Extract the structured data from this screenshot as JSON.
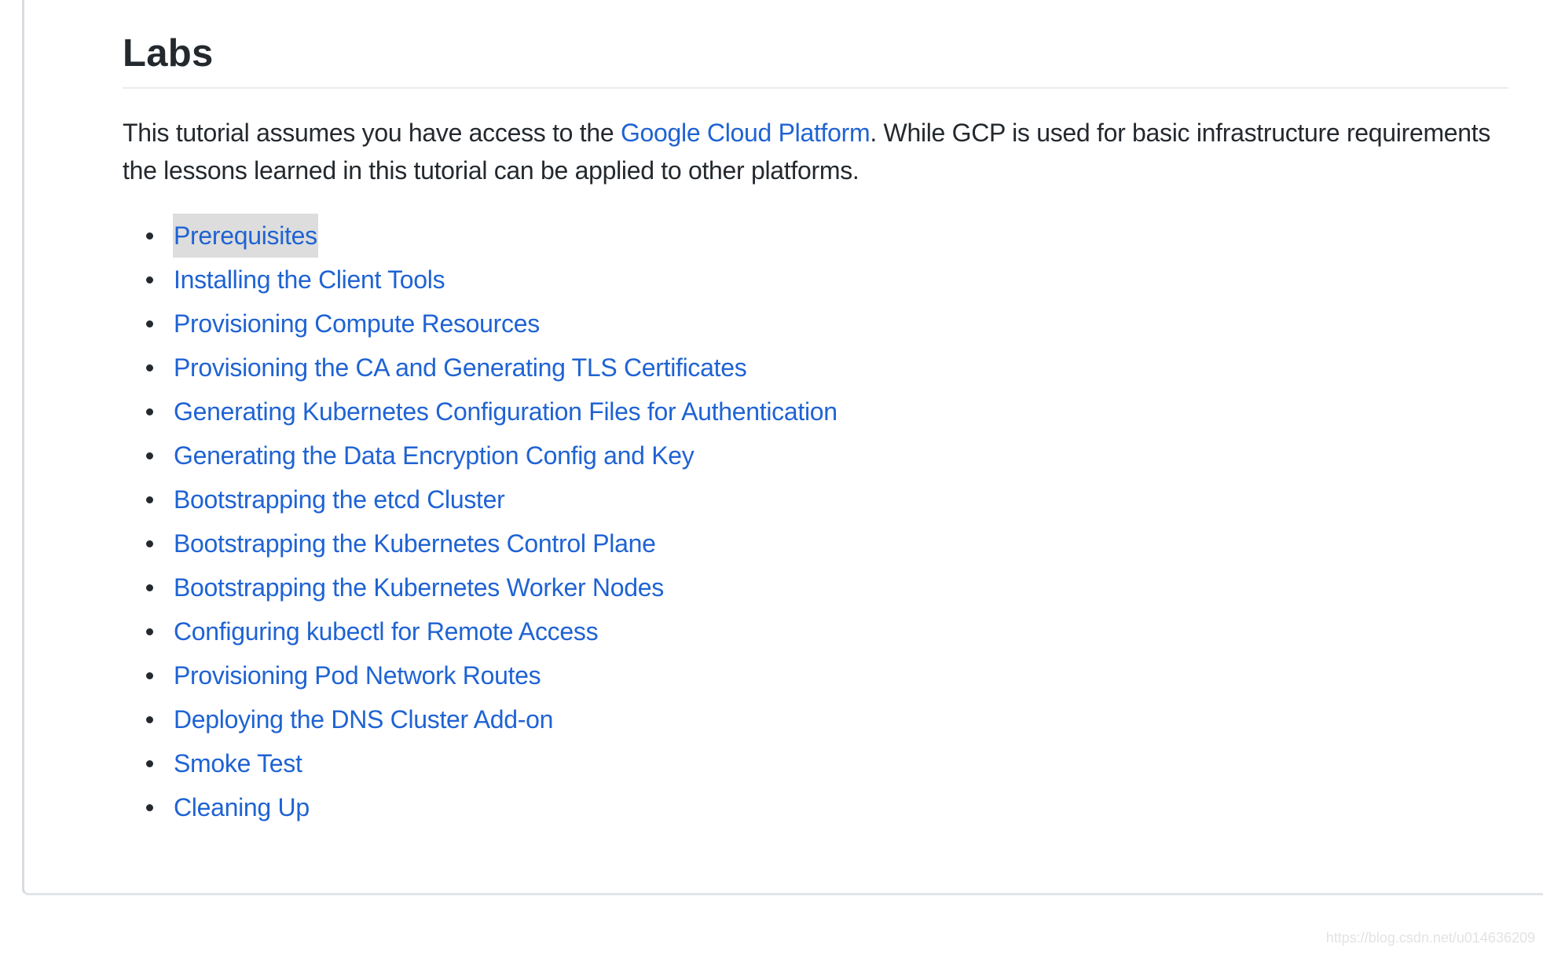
{
  "heading": "Labs",
  "intro": {
    "before_link": "This tutorial assumes you have access to the ",
    "link_text": "Google Cloud Platform",
    "after_link": ". While GCP is used for basic infrastructure requirements the lessons learned in this tutorial can be applied to other platforms."
  },
  "labs": [
    {
      "label": "Prerequisites",
      "highlighted": true
    },
    {
      "label": "Installing the Client Tools"
    },
    {
      "label": "Provisioning Compute Resources"
    },
    {
      "label": "Provisioning the CA and Generating TLS Certificates"
    },
    {
      "label": "Generating Kubernetes Configuration Files for Authentication"
    },
    {
      "label": "Generating the Data Encryption Config and Key"
    },
    {
      "label": "Bootstrapping the etcd Cluster"
    },
    {
      "label": "Bootstrapping the Kubernetes Control Plane"
    },
    {
      "label": "Bootstrapping the Kubernetes Worker Nodes"
    },
    {
      "label": "Configuring kubectl for Remote Access"
    },
    {
      "label": "Provisioning Pod Network Routes"
    },
    {
      "label": "Deploying the DNS Cluster Add-on"
    },
    {
      "label": "Smoke Test"
    },
    {
      "label": "Cleaning Up"
    }
  ],
  "watermark": "https://blog.csdn.net/u014636209",
  "colors": {
    "link": "#1f63d3",
    "text": "#24292e",
    "highlight": "#dddddd"
  }
}
